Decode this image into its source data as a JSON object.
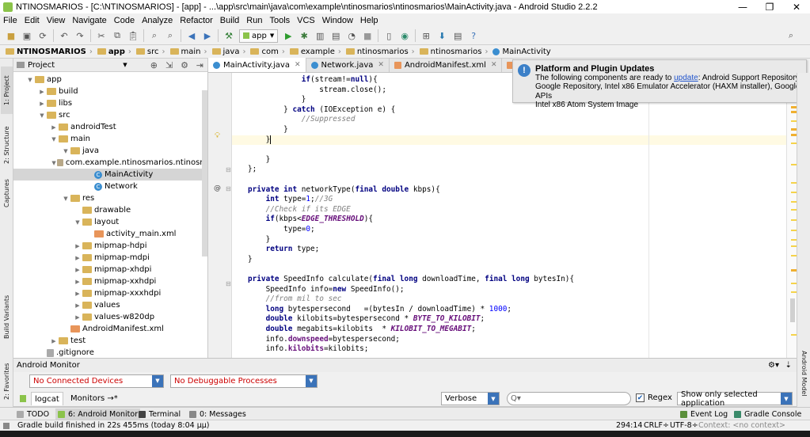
{
  "window": {
    "title": "NTINOSMARIOS - [C:\\NTINOSMARIOS] - [app] - ...\\app\\src\\main\\java\\com\\example\\ntinosmarios\\ntinosmarios\\MainActivity.java - Android Studio 2.2.2",
    "minimize": "—",
    "maximize": "❐",
    "close": "✕"
  },
  "menu": [
    "File",
    "Edit",
    "View",
    "Navigate",
    "Code",
    "Analyze",
    "Refactor",
    "Build",
    "Run",
    "Tools",
    "VCS",
    "Window",
    "Help"
  ],
  "toolbar": {
    "run_config": "app"
  },
  "breadcrumbs": [
    "NTINOSMARIOS",
    "app",
    "src",
    "main",
    "java",
    "com",
    "example",
    "ntinosmarios",
    "ntinosmarios",
    "MainActivity"
  ],
  "left_tool_tabs": [
    "1: Project",
    "2: Structure",
    "Captures",
    "Build Variants",
    "2: Favorites"
  ],
  "right_tool_tabs": [
    "Android Model"
  ],
  "project_panel": {
    "view": "Project",
    "tree": [
      {
        "label": "app",
        "icon": "folder",
        "depth": 0,
        "arrow": "▼"
      },
      {
        "label": "build",
        "icon": "folder",
        "depth": 1,
        "arrow": "▶"
      },
      {
        "label": "libs",
        "icon": "folder",
        "depth": 1,
        "arrow": "▶"
      },
      {
        "label": "src",
        "icon": "folder",
        "depth": 1,
        "arrow": "▼"
      },
      {
        "label": "androidTest",
        "icon": "folder",
        "depth": 2,
        "arrow": "▶"
      },
      {
        "label": "main",
        "icon": "folder",
        "depth": 2,
        "arrow": "▼"
      },
      {
        "label": "java",
        "icon": "folder",
        "depth": 3,
        "arrow": "▼"
      },
      {
        "label": "com.example.ntinosmarios.ntinosm",
        "icon": "pkg",
        "depth": 4,
        "arrow": "▼"
      },
      {
        "label": "MainActivity",
        "icon": "cls",
        "depth": 5,
        "arrow": "",
        "selected": true
      },
      {
        "label": "Network",
        "icon": "cls",
        "depth": 5,
        "arrow": ""
      },
      {
        "label": "res",
        "icon": "folder",
        "depth": 3,
        "arrow": "▼"
      },
      {
        "label": "drawable",
        "icon": "folder",
        "depth": 4,
        "arrow": ""
      },
      {
        "label": "layout",
        "icon": "folder",
        "depth": 4,
        "arrow": "▼"
      },
      {
        "label": "activity_main.xml",
        "icon": "xml",
        "depth": 5,
        "arrow": ""
      },
      {
        "label": "mipmap-hdpi",
        "icon": "folder",
        "depth": 4,
        "arrow": "▶"
      },
      {
        "label": "mipmap-mdpi",
        "icon": "folder",
        "depth": 4,
        "arrow": "▶"
      },
      {
        "label": "mipmap-xhdpi",
        "icon": "folder",
        "depth": 4,
        "arrow": "▶"
      },
      {
        "label": "mipmap-xxhdpi",
        "icon": "folder",
        "depth": 4,
        "arrow": "▶"
      },
      {
        "label": "mipmap-xxxhdpi",
        "icon": "folder",
        "depth": 4,
        "arrow": "▶"
      },
      {
        "label": "values",
        "icon": "folder",
        "depth": 4,
        "arrow": "▶"
      },
      {
        "label": "values-w820dp",
        "icon": "folder",
        "depth": 4,
        "arrow": "▶"
      },
      {
        "label": "AndroidManifest.xml",
        "icon": "xml",
        "depth": 3,
        "arrow": ""
      },
      {
        "label": "test",
        "icon": "folder",
        "depth": 2,
        "arrow": "▶"
      },
      {
        "label": ".gitignore",
        "icon": "file",
        "depth": 1,
        "arrow": ""
      }
    ]
  },
  "editor_tabs": [
    {
      "label": "MainActivity.java",
      "active": true,
      "color": "#3b8ed0"
    },
    {
      "label": "Network.java",
      "active": false,
      "color": "#3b8ed0"
    },
    {
      "label": "AndroidManifest.xml",
      "active": false,
      "color": "#e8955a"
    },
    {
      "label": "activity_mai",
      "active": false,
      "color": "#e8955a"
    }
  ],
  "code_lines": [
    [
      [
        "",
        "            "
      ],
      [
        "kw",
        "if"
      ],
      [
        "",
        "(stream!="
      ],
      [
        "kw",
        "null"
      ],
      [
        "",
        "){"
      ]
    ],
    [
      [
        "",
        "                stream.close();"
      ]
    ],
    [
      [
        "",
        "            }"
      ]
    ],
    [
      [
        "",
        "        } "
      ],
      [
        "kw",
        "catch"
      ],
      [
        "",
        " (IOException e) {"
      ]
    ],
    [
      [
        "",
        "            "
      ],
      [
        "cm",
        "//Suppressed"
      ]
    ],
    [
      [
        "",
        "        }"
      ]
    ],
    [
      [
        "",
        "    }"
      ]
    ],
    [
      [
        "",
        ""
      ]
    ],
    [
      [
        "",
        "    }"
      ]
    ],
    [
      [
        "",
        "};"
      ]
    ],
    [
      [
        "",
        ""
      ]
    ],
    [
      [
        "kw",
        "private int"
      ],
      [
        "",
        " networkType("
      ],
      [
        "kw",
        "final double"
      ],
      [
        "",
        " kbps){"
      ]
    ],
    [
      [
        "",
        "    "
      ],
      [
        "kw",
        "int"
      ],
      [
        "",
        " type="
      ],
      [
        "num",
        "1"
      ],
      [
        "",
        ";"
      ],
      [
        "cm",
        "//3G"
      ]
    ],
    [
      [
        "",
        "    "
      ],
      [
        "cm",
        "//Check if its EDGE"
      ]
    ],
    [
      [
        "",
        "    "
      ],
      [
        "kw",
        "if"
      ],
      [
        "",
        "(kbps<"
      ],
      [
        "cst",
        "EDGE_THRESHOLD"
      ],
      [
        "",
        "){"
      ]
    ],
    [
      [
        "",
        "        type="
      ],
      [
        "num",
        "0"
      ],
      [
        "",
        ";"
      ]
    ],
    [
      [
        "",
        "    }"
      ]
    ],
    [
      [
        "",
        "    "
      ],
      [
        "kw",
        "return"
      ],
      [
        "",
        " type;"
      ]
    ],
    [
      [
        "",
        "}"
      ]
    ],
    [
      [
        "",
        ""
      ]
    ],
    [
      [
        "kw",
        "private"
      ],
      [
        "",
        " SpeedInfo calculate("
      ],
      [
        "kw",
        "final long"
      ],
      [
        "",
        " downloadTime, "
      ],
      [
        "kw",
        "final long"
      ],
      [
        "",
        " bytesIn){"
      ]
    ],
    [
      [
        "",
        "    SpeedInfo info="
      ],
      [
        "kw",
        "new"
      ],
      [
        "",
        " SpeedInfo();"
      ]
    ],
    [
      [
        "",
        "    "
      ],
      [
        "cm",
        "//from mil to sec"
      ]
    ],
    [
      [
        "",
        "    "
      ],
      [
        "kw",
        "long"
      ],
      [
        "",
        " bytespersecond   =(bytesIn / downloadTime) * "
      ],
      [
        "num",
        "1000"
      ],
      [
        "",
        ";"
      ]
    ],
    [
      [
        "",
        "    "
      ],
      [
        "kw",
        "double"
      ],
      [
        "",
        " kilobits=bytespersecond * "
      ],
      [
        "cst",
        "BYTE_TO_KILOBIT"
      ],
      [
        "",
        ";"
      ]
    ],
    [
      [
        "",
        "    "
      ],
      [
        "kw",
        "double"
      ],
      [
        "",
        " megabits=kilobits  * "
      ],
      [
        "cst",
        "KILOBIT_TO_MEGABIT"
      ],
      [
        "",
        ";"
      ]
    ],
    [
      [
        "",
        "    info."
      ],
      [
        "fld",
        "downspeed"
      ],
      [
        "",
        "=bytespersecond;"
      ]
    ],
    [
      [
        "",
        "    info."
      ],
      [
        "fld",
        "kilobits"
      ],
      [
        "",
        "=kilobits;"
      ]
    ]
  ],
  "notification": {
    "title": "Platform and Plugin Updates",
    "line1_pre": "The following components are ready to ",
    "link": "update",
    "line1_post": ": Android Support Repository,",
    "line2": "Google Repository, Intel x86 Emulator Accelerator (HAXM installer), Google APIs",
    "line3": "Intel x86 Atom System Image"
  },
  "android_monitor": {
    "title": "Android Monitor",
    "devices": "No Connected Devices",
    "processes": "No Debuggable Processes",
    "tabs": [
      "logcat",
      "Monitors →*"
    ],
    "log_level": "Verbose",
    "search_prefix": "Q▾",
    "regex_label": "Regex",
    "filter": "Show only selected application"
  },
  "tool_buttons": {
    "todo": "TODO",
    "android_monitor": "6: Android Monitor",
    "terminal": "Terminal",
    "messages": "0: Messages",
    "event_log": "Event Log",
    "gradle_console": "Gradle Console"
  },
  "status": {
    "message": "Gradle build finished in 22s 455ms (today 8:04 μμ)",
    "position": "294:14",
    "line_sep": "CRLF÷",
    "encoding": "UTF-8÷",
    "context": "Context: <no context>"
  },
  "colors": {
    "accent": "#3b73b9",
    "error_text": "#cc0000",
    "caret_line": "#fffae3"
  }
}
